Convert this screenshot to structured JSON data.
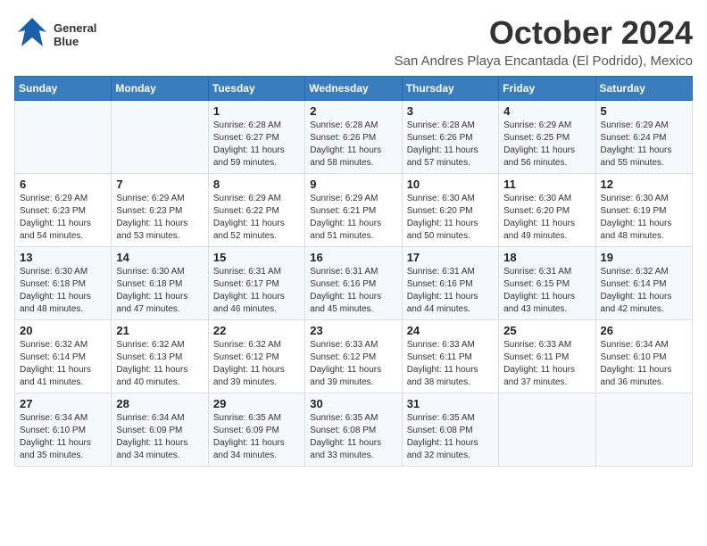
{
  "header": {
    "logo_line1": "General",
    "logo_line2": "Blue",
    "month": "October 2024",
    "location": "San Andres Playa Encantada (El Podrido), Mexico"
  },
  "weekdays": [
    "Sunday",
    "Monday",
    "Tuesday",
    "Wednesday",
    "Thursday",
    "Friday",
    "Saturday"
  ],
  "weeks": [
    [
      {
        "day": "",
        "sunrise": "",
        "sunset": "",
        "daylight": ""
      },
      {
        "day": "",
        "sunrise": "",
        "sunset": "",
        "daylight": ""
      },
      {
        "day": "1",
        "sunrise": "Sunrise: 6:28 AM",
        "sunset": "Sunset: 6:27 PM",
        "daylight": "Daylight: 11 hours and 59 minutes."
      },
      {
        "day": "2",
        "sunrise": "Sunrise: 6:28 AM",
        "sunset": "Sunset: 6:26 PM",
        "daylight": "Daylight: 11 hours and 58 minutes."
      },
      {
        "day": "3",
        "sunrise": "Sunrise: 6:28 AM",
        "sunset": "Sunset: 6:26 PM",
        "daylight": "Daylight: 11 hours and 57 minutes."
      },
      {
        "day": "4",
        "sunrise": "Sunrise: 6:29 AM",
        "sunset": "Sunset: 6:25 PM",
        "daylight": "Daylight: 11 hours and 56 minutes."
      },
      {
        "day": "5",
        "sunrise": "Sunrise: 6:29 AM",
        "sunset": "Sunset: 6:24 PM",
        "daylight": "Daylight: 11 hours and 55 minutes."
      }
    ],
    [
      {
        "day": "6",
        "sunrise": "Sunrise: 6:29 AM",
        "sunset": "Sunset: 6:23 PM",
        "daylight": "Daylight: 11 hours and 54 minutes."
      },
      {
        "day": "7",
        "sunrise": "Sunrise: 6:29 AM",
        "sunset": "Sunset: 6:23 PM",
        "daylight": "Daylight: 11 hours and 53 minutes."
      },
      {
        "day": "8",
        "sunrise": "Sunrise: 6:29 AM",
        "sunset": "Sunset: 6:22 PM",
        "daylight": "Daylight: 11 hours and 52 minutes."
      },
      {
        "day": "9",
        "sunrise": "Sunrise: 6:29 AM",
        "sunset": "Sunset: 6:21 PM",
        "daylight": "Daylight: 11 hours and 51 minutes."
      },
      {
        "day": "10",
        "sunrise": "Sunrise: 6:30 AM",
        "sunset": "Sunset: 6:20 PM",
        "daylight": "Daylight: 11 hours and 50 minutes."
      },
      {
        "day": "11",
        "sunrise": "Sunrise: 6:30 AM",
        "sunset": "Sunset: 6:20 PM",
        "daylight": "Daylight: 11 hours and 49 minutes."
      },
      {
        "day": "12",
        "sunrise": "Sunrise: 6:30 AM",
        "sunset": "Sunset: 6:19 PM",
        "daylight": "Daylight: 11 hours and 48 minutes."
      }
    ],
    [
      {
        "day": "13",
        "sunrise": "Sunrise: 6:30 AM",
        "sunset": "Sunset: 6:18 PM",
        "daylight": "Daylight: 11 hours and 48 minutes."
      },
      {
        "day": "14",
        "sunrise": "Sunrise: 6:30 AM",
        "sunset": "Sunset: 6:18 PM",
        "daylight": "Daylight: 11 hours and 47 minutes."
      },
      {
        "day": "15",
        "sunrise": "Sunrise: 6:31 AM",
        "sunset": "Sunset: 6:17 PM",
        "daylight": "Daylight: 11 hours and 46 minutes."
      },
      {
        "day": "16",
        "sunrise": "Sunrise: 6:31 AM",
        "sunset": "Sunset: 6:16 PM",
        "daylight": "Daylight: 11 hours and 45 minutes."
      },
      {
        "day": "17",
        "sunrise": "Sunrise: 6:31 AM",
        "sunset": "Sunset: 6:16 PM",
        "daylight": "Daylight: 11 hours and 44 minutes."
      },
      {
        "day": "18",
        "sunrise": "Sunrise: 6:31 AM",
        "sunset": "Sunset: 6:15 PM",
        "daylight": "Daylight: 11 hours and 43 minutes."
      },
      {
        "day": "19",
        "sunrise": "Sunrise: 6:32 AM",
        "sunset": "Sunset: 6:14 PM",
        "daylight": "Daylight: 11 hours and 42 minutes."
      }
    ],
    [
      {
        "day": "20",
        "sunrise": "Sunrise: 6:32 AM",
        "sunset": "Sunset: 6:14 PM",
        "daylight": "Daylight: 11 hours and 41 minutes."
      },
      {
        "day": "21",
        "sunrise": "Sunrise: 6:32 AM",
        "sunset": "Sunset: 6:13 PM",
        "daylight": "Daylight: 11 hours and 40 minutes."
      },
      {
        "day": "22",
        "sunrise": "Sunrise: 6:32 AM",
        "sunset": "Sunset: 6:12 PM",
        "daylight": "Daylight: 11 hours and 39 minutes."
      },
      {
        "day": "23",
        "sunrise": "Sunrise: 6:33 AM",
        "sunset": "Sunset: 6:12 PM",
        "daylight": "Daylight: 11 hours and 39 minutes."
      },
      {
        "day": "24",
        "sunrise": "Sunrise: 6:33 AM",
        "sunset": "Sunset: 6:11 PM",
        "daylight": "Daylight: 11 hours and 38 minutes."
      },
      {
        "day": "25",
        "sunrise": "Sunrise: 6:33 AM",
        "sunset": "Sunset: 6:11 PM",
        "daylight": "Daylight: 11 hours and 37 minutes."
      },
      {
        "day": "26",
        "sunrise": "Sunrise: 6:34 AM",
        "sunset": "Sunset: 6:10 PM",
        "daylight": "Daylight: 11 hours and 36 minutes."
      }
    ],
    [
      {
        "day": "27",
        "sunrise": "Sunrise: 6:34 AM",
        "sunset": "Sunset: 6:10 PM",
        "daylight": "Daylight: 11 hours and 35 minutes."
      },
      {
        "day": "28",
        "sunrise": "Sunrise: 6:34 AM",
        "sunset": "Sunset: 6:09 PM",
        "daylight": "Daylight: 11 hours and 34 minutes."
      },
      {
        "day": "29",
        "sunrise": "Sunrise: 6:35 AM",
        "sunset": "Sunset: 6:09 PM",
        "daylight": "Daylight: 11 hours and 34 minutes."
      },
      {
        "day": "30",
        "sunrise": "Sunrise: 6:35 AM",
        "sunset": "Sunset: 6:08 PM",
        "daylight": "Daylight: 11 hours and 33 minutes."
      },
      {
        "day": "31",
        "sunrise": "Sunrise: 6:35 AM",
        "sunset": "Sunset: 6:08 PM",
        "daylight": "Daylight: 11 hours and 32 minutes."
      },
      {
        "day": "",
        "sunrise": "",
        "sunset": "",
        "daylight": ""
      },
      {
        "day": "",
        "sunrise": "",
        "sunset": "",
        "daylight": ""
      }
    ]
  ]
}
